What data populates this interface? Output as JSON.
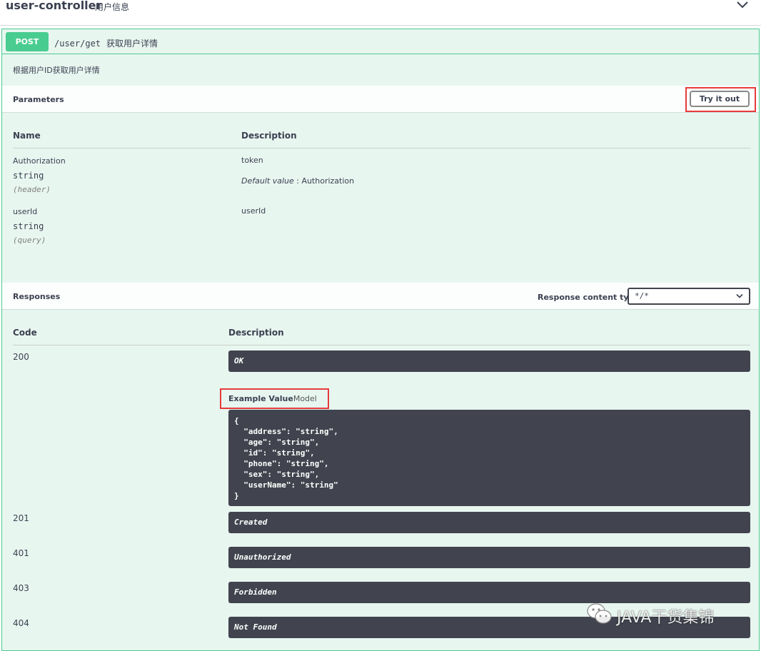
{
  "header": {
    "tag_name": "user-controller",
    "tag_desc": "用户信息"
  },
  "operation": {
    "method": "POST",
    "path": "/user/get",
    "summary": "获取用户详情",
    "description": "根据用户ID获取用户详情"
  },
  "parameters": {
    "title": "Parameters",
    "try_label": "Try it out",
    "col_name": "Name",
    "col_desc": "Description",
    "rows": [
      {
        "name": "Authorization",
        "type": "string",
        "in": "(header)",
        "desc": "token",
        "default_label": "Default value",
        "default_sep": " : ",
        "default_value": "Authorization"
      },
      {
        "name": "userId",
        "type": "string",
        "in": "(query)",
        "desc": "userId"
      }
    ]
  },
  "responses": {
    "title": "Responses",
    "content_type_label": "Response content type",
    "content_type_value": "*/*",
    "col_code": "Code",
    "col_desc": "Description",
    "example_tab_active": "Example Value",
    "example_tab_inactive": "Model",
    "example_json": "{\n  \"address\": \"string\",\n  \"age\": \"string\",\n  \"id\": \"string\",\n  \"phone\": \"string\",\n  \"sex\": \"string\",\n  \"userName\": \"string\"\n}",
    "rows": [
      {
        "code": "200",
        "desc": "OK"
      },
      {
        "code": "201",
        "desc": "Created"
      },
      {
        "code": "401",
        "desc": "Unauthorized"
      },
      {
        "code": "403",
        "desc": "Forbidden"
      },
      {
        "code": "404",
        "desc": "Not Found"
      }
    ]
  },
  "watermark": {
    "text": "JAVA干货集锦"
  },
  "colors": {
    "post_green": "#49cc90",
    "opblock_bg": "#e8f6f0",
    "dark_bar": "#41444e",
    "highlight_red": "#e63b3b"
  },
  "icons": {
    "collapse": "chevron-down-icon",
    "select_arrow": "chevron-down-icon",
    "watermark": "wechat-icon"
  }
}
